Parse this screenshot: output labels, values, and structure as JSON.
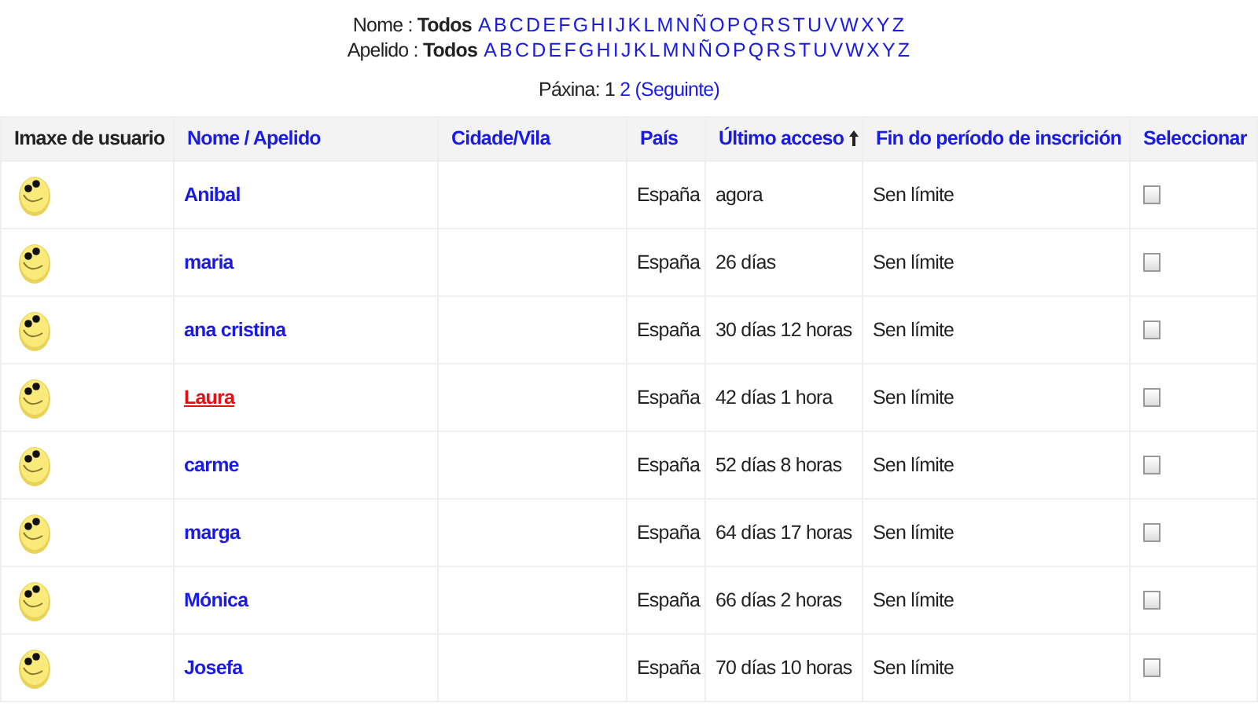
{
  "filters": [
    {
      "label": "Nome :",
      "all": "Todos",
      "letters": [
        "A",
        "B",
        "C",
        "D",
        "E",
        "F",
        "G",
        "H",
        "I",
        "J",
        "K",
        "L",
        "M",
        "N",
        "Ñ",
        "O",
        "P",
        "Q",
        "R",
        "S",
        "T",
        "U",
        "V",
        "W",
        "X",
        "Y",
        "Z"
      ]
    },
    {
      "label": "Apelido :",
      "all": "Todos",
      "letters": [
        "A",
        "B",
        "C",
        "D",
        "E",
        "F",
        "G",
        "H",
        "I",
        "J",
        "K",
        "L",
        "M",
        "N",
        "Ñ",
        "O",
        "P",
        "Q",
        "R",
        "S",
        "T",
        "U",
        "V",
        "W",
        "X",
        "Y",
        "Z"
      ]
    }
  ],
  "paging": {
    "label": "Páxina:",
    "pages": [
      {
        "label": "1",
        "selected": true
      },
      {
        "label": "2",
        "selected": false
      }
    ],
    "next": "(Seguinte)"
  },
  "table": {
    "columns": [
      {
        "label": "Imaxe de usuario",
        "link": false
      },
      {
        "label": "Nome / Apelido",
        "link": true,
        "sorted": false
      },
      {
        "label": "Cidade/Vila",
        "link": true,
        "sorted": false
      },
      {
        "label": "País",
        "link": true,
        "sorted": false
      },
      {
        "label": "Último acceso",
        "link": true,
        "sorted": true
      },
      {
        "label": "Fin do período de inscrición",
        "link": true,
        "sorted": false
      },
      {
        "label": "Seleccionar",
        "link": true,
        "sorted": false
      }
    ],
    "rows": [
      {
        "name": "Anibal",
        "country": "España",
        "last_access": "agora",
        "end": "Sen límite",
        "checked": false,
        "hovered": false
      },
      {
        "name": "maria",
        "country": "España",
        "last_access": "26 días",
        "end": "Sen límite",
        "checked": false,
        "hovered": false
      },
      {
        "name": "ana cristina",
        "country": "España",
        "last_access": "30 días 12 horas",
        "end": "Sen límite",
        "checked": false,
        "hovered": false
      },
      {
        "name": "Laura",
        "country": "España",
        "last_access": "42 días 1 hora",
        "end": "Sen límite",
        "checked": false,
        "hovered": true
      },
      {
        "name": "carme",
        "country": "España",
        "last_access": "52 días 8 horas",
        "end": "Sen límite",
        "checked": false,
        "hovered": false
      },
      {
        "name": "marga",
        "country": "España",
        "last_access": "64 días 17 horas",
        "end": "Sen límite",
        "checked": false,
        "hovered": false
      },
      {
        "name": "Mónica",
        "country": "España",
        "last_access": "66 días 2 horas",
        "end": "Sen límite",
        "checked": false,
        "hovered": false
      },
      {
        "name": "Josefa",
        "country": "España",
        "last_access": "70 días 10 horas",
        "end": "Sen límite",
        "checked": false,
        "hovered": false
      }
    ]
  }
}
